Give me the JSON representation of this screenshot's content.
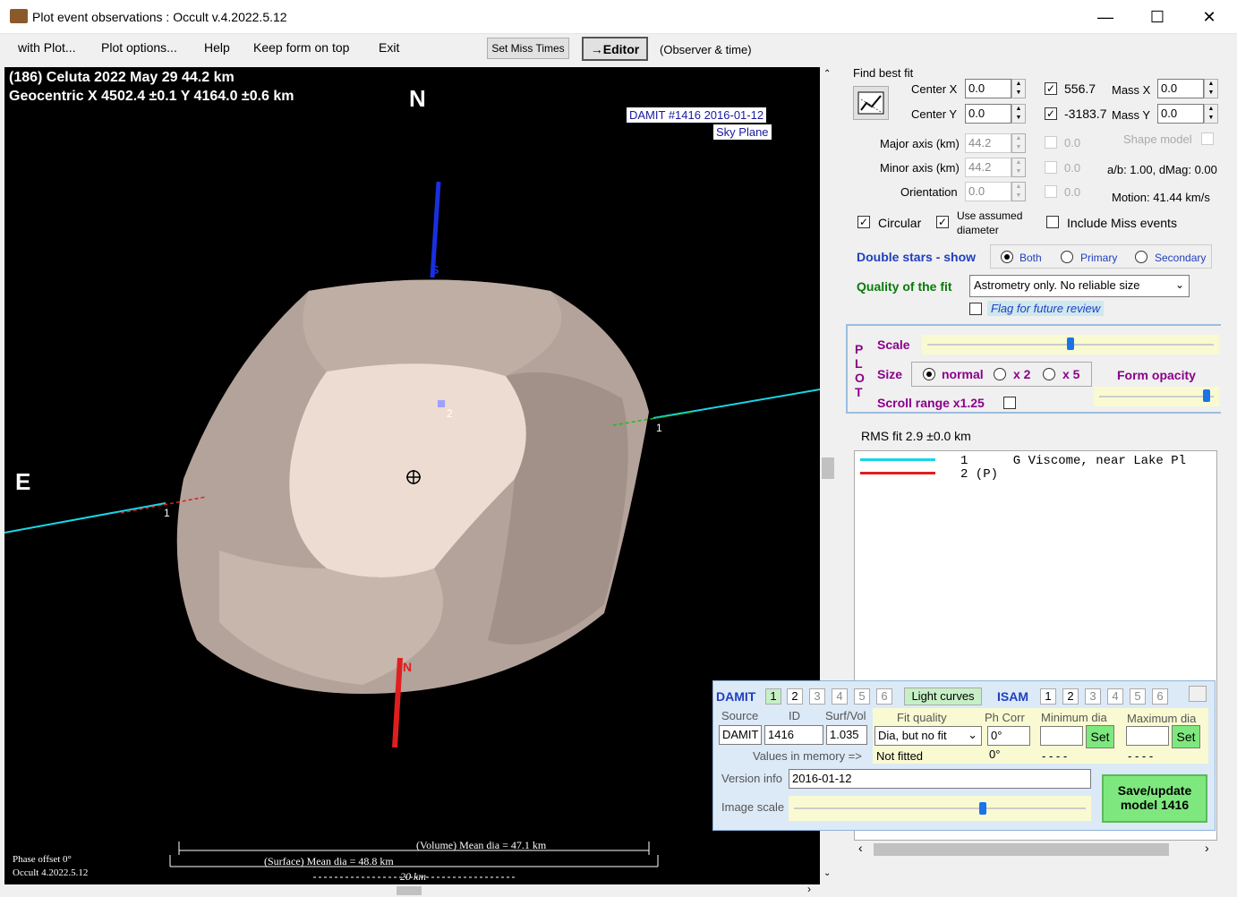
{
  "window": {
    "title": "Plot event observations : Occult v.4.2022.5.12"
  },
  "menu": {
    "with_plot": "with Plot...",
    "plot_options": "Plot options...",
    "help": "Help",
    "keep_on_top": "Keep form on top",
    "exit": "Exit",
    "set_miss_times": "Set Miss Times",
    "editor": "→Editor",
    "observer_time": "(Observer & time)"
  },
  "plot": {
    "header_line1": "(186) Celuta  2022 May 29   44.2 km",
    "header_line2": "Geocentric  X  4502.4 ±0.1  Y 4164.0 ±0.6 km",
    "north": "N",
    "east": "E",
    "damit_tag": "DAMIT #1416 2016-01-12",
    "sky_plane": "Sky Plane",
    "pole_s": "S",
    "pole_n": "N",
    "chord1_label": "1",
    "chord1b_label": "1",
    "chord2_label": "2",
    "volume_dia": "(Volume) Mean dia = 47.1 km",
    "surface_dia": "(Surface) Mean dia = 48.8 km",
    "scale_km": "20 km",
    "phase_offset": "Phase offset 0°",
    "version": "Occult 4.2022.5.12"
  },
  "fit": {
    "find_best_fit": "Find best fit",
    "center_x_label": "Center X",
    "center_x": "0.0",
    "center_y_label": "Center Y",
    "center_y": "0.0",
    "val1": "556.7",
    "val2": "-3183.7",
    "mass_x_label": "Mass X",
    "mass_x": "0.0",
    "mass_y_label": "Mass Y",
    "mass_y": "0.0",
    "major_label": "Major axis (km)",
    "major": "44.2",
    "minor_label": "Minor axis (km)",
    "minor": "44.2",
    "orient_label": "Orientation",
    "orient": "0.0",
    "zero1": "0.0",
    "zero2": "0.0",
    "zero3": "0.0",
    "shape_model": "Shape model",
    "ab_dmag": "a/b: 1.00, dMag: 0.00",
    "motion": "Motion: 41.44 km/s",
    "circular": "Circular",
    "use_assumed": "Use assumed diameter",
    "include_miss": "Include Miss events",
    "double_stars": "Double stars - show",
    "both": "Both",
    "primary": "Primary",
    "secondary": "Secondary",
    "quality_label": "Quality of the fit",
    "quality_value": "Astrometry only. No reliable size",
    "flag_review": "Flag for future review"
  },
  "plotpanel": {
    "letters": [
      "P",
      "L",
      "O",
      "T"
    ],
    "scale": "Scale",
    "size": "Size",
    "normal": "normal",
    "x2": "x 2",
    "x5": "x 5",
    "form_opacity": "Form opacity",
    "scroll_range": "Scroll range x1.25",
    "scale_level": 0.5,
    "opacity_level": 0.97
  },
  "rms": "RMS fit 2.9 ±0.0 km",
  "legend": [
    {
      "color": "#19d6e6",
      "text": "1      G Viscome, near Lake Pl"
    },
    {
      "color": "#e01e1e",
      "text": "2 (P)"
    }
  ],
  "damit": {
    "damit_label": "DAMIT",
    "damit_tabs": [
      "1",
      "2",
      "3",
      "4",
      "5",
      "6"
    ],
    "light_curves": "Light curves",
    "isam_label": "ISAM",
    "isam_tabs": [
      "1",
      "2",
      "3",
      "4",
      "5",
      "6"
    ],
    "source_h": "Source",
    "id_h": "ID",
    "surfvol_h": "Surf/Vol",
    "fitq_h": "Fit quality",
    "phcorr_h": "Ph Corr",
    "mindia_h": "Minimum dia",
    "maxdia_h": "Maximum dia",
    "source": "DAMIT",
    "id": "1416",
    "surfvol": "1.035",
    "fitq": "Dia, but no fit",
    "phcorr": "0°",
    "set": "Set",
    "set2": "Set",
    "values_mem": "Values in memory =>",
    "not_fitted": "Not fitted",
    "phcorr_mem": "0°",
    "dash1": "- - - -",
    "dash2": "- - - -",
    "version_label": "Version info",
    "version": "2016-01-12",
    "image_scale": "Image scale",
    "image_scale_level": 0.65,
    "save_btn1": "Save/update",
    "save_btn2": "model 1416"
  }
}
